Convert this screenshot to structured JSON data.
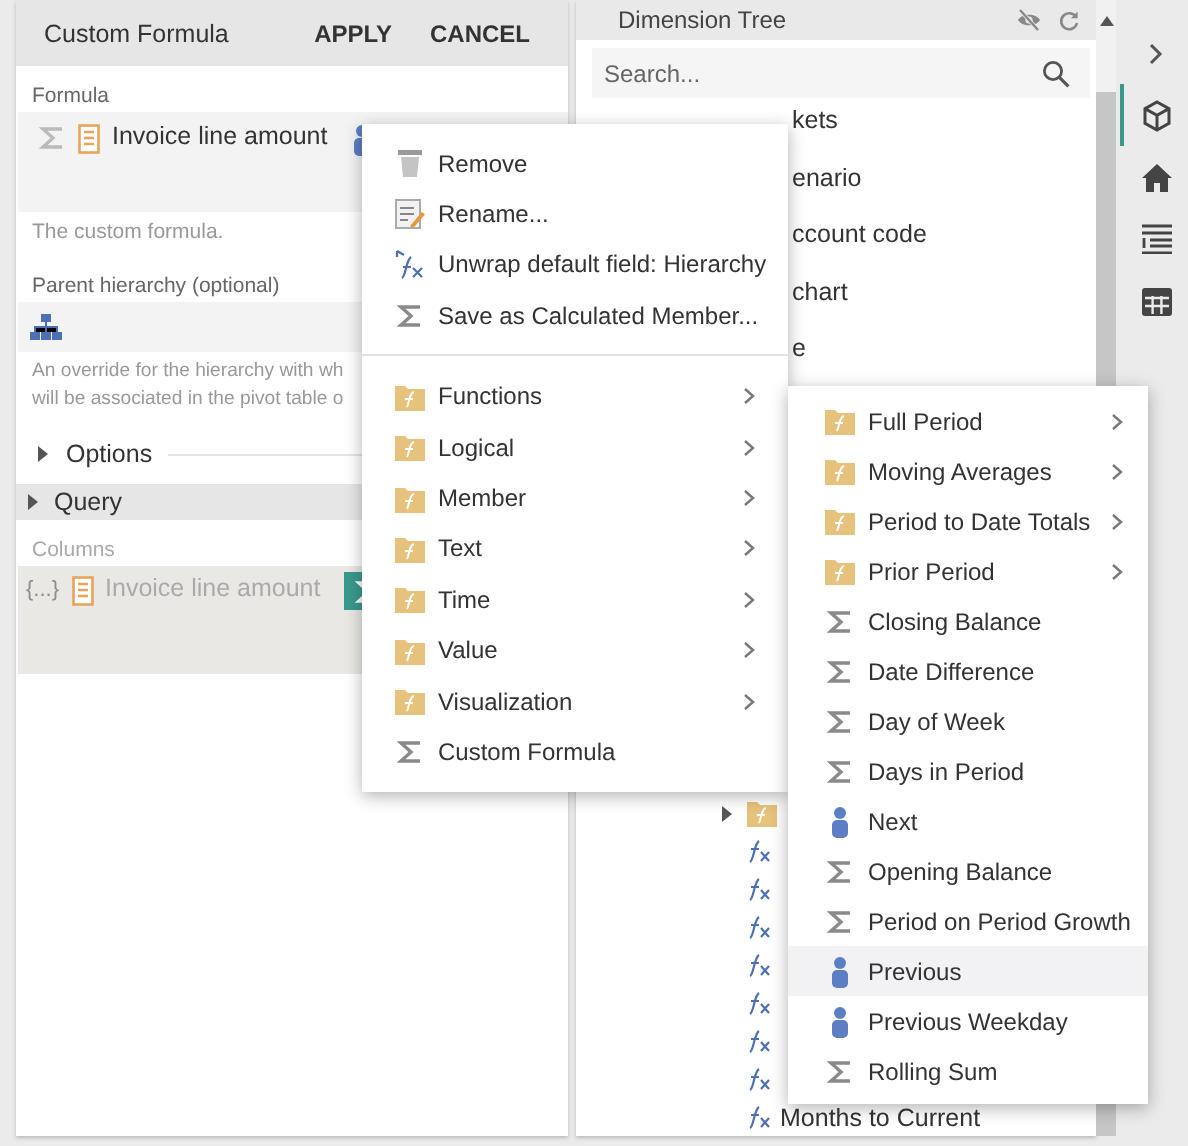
{
  "left_panel": {
    "title": "Custom Formula",
    "actions": [
      "APPLY",
      "CANCEL"
    ],
    "formula": {
      "label": "Formula",
      "tokens": [
        {
          "kind": "function"
        },
        {
          "kind": "field",
          "text": "Invoice line amount"
        },
        {
          "kind": "member"
        }
      ],
      "hint": "The custom formula."
    },
    "parent_hierarchy": {
      "label": "Parent hierarchy (optional)",
      "description_lines": [
        "An override for the hierarchy with wh",
        "will be associated in the pivot table o"
      ]
    },
    "options": {
      "label": "Options",
      "expanded": false
    },
    "query": {
      "label": "Query",
      "expanded": false,
      "columns_label": "Columns",
      "columns": [
        {
          "kind": "set",
          "text": "{...}"
        },
        {
          "kind": "field",
          "text": "Invoice line amount"
        },
        {
          "kind": "measure-chip"
        }
      ]
    }
  },
  "dimension_tree": {
    "title": "Dimension Tree",
    "search": {
      "placeholder": "Search..."
    },
    "top_rows": [
      {
        "text": "kets"
      },
      {
        "text": "enario"
      },
      {
        "text": "ccount code"
      },
      {
        "text": "chart"
      },
      {
        "text": "e"
      }
    ],
    "lower_rows": [
      {
        "kind": "folder",
        "expandable": true
      },
      {
        "kind": "function",
        "expandable": false
      },
      {
        "kind": "function",
        "expandable": false
      },
      {
        "kind": "function",
        "expandable": false
      },
      {
        "kind": "function",
        "expandable": false
      },
      {
        "kind": "function",
        "expandable": false
      },
      {
        "kind": "function",
        "expandable": false
      },
      {
        "kind": "function",
        "expandable": false
      },
      {
        "kind": "function",
        "expandable": false,
        "text": "Months to Current"
      }
    ]
  },
  "sidebar": {
    "items": [
      {
        "kind": "expand",
        "selected": false
      },
      {
        "kind": "model",
        "selected": true
      },
      {
        "kind": "home",
        "selected": false
      },
      {
        "kind": "fields",
        "selected": false
      },
      {
        "kind": "table",
        "selected": false
      }
    ]
  },
  "context_menu": {
    "groups": [
      [
        {
          "kind": "remove",
          "label": "Remove",
          "submenu": false
        },
        {
          "kind": "rename",
          "label": "Rename...",
          "submenu": false
        },
        {
          "kind": "unwrap",
          "label": "Unwrap default field: Hierarchy",
          "submenu": false
        },
        {
          "kind": "measure",
          "label": "Save as Calculated Member...",
          "submenu": false
        }
      ],
      [
        {
          "kind": "folder",
          "label": "Functions",
          "submenu": true
        },
        {
          "kind": "folder",
          "label": "Logical",
          "submenu": true
        },
        {
          "kind": "folder",
          "label": "Member",
          "submenu": true
        },
        {
          "kind": "folder",
          "label": "Text",
          "submenu": true
        },
        {
          "kind": "folder",
          "label": "Time",
          "submenu": true
        },
        {
          "kind": "folder",
          "label": "Value",
          "submenu": true
        },
        {
          "kind": "folder",
          "label": "Visualization",
          "submenu": true
        },
        {
          "kind": "measure",
          "label": "Custom Formula",
          "submenu": false
        }
      ]
    ]
  },
  "submenu": {
    "items": [
      {
        "kind": "folder",
        "label": "Full Period",
        "submenu": true,
        "selected": false
      },
      {
        "kind": "folder",
        "label": "Moving Averages",
        "submenu": true,
        "selected": false
      },
      {
        "kind": "folder",
        "label": "Period to Date Totals",
        "submenu": true,
        "selected": false
      },
      {
        "kind": "folder",
        "label": "Prior Period",
        "submenu": true,
        "selected": false
      },
      {
        "kind": "measure",
        "label": "Closing Balance",
        "submenu": false,
        "selected": false
      },
      {
        "kind": "measure",
        "label": "Date Difference",
        "submenu": false,
        "selected": false
      },
      {
        "kind": "measure",
        "label": "Day of Week",
        "submenu": false,
        "selected": false
      },
      {
        "kind": "measure",
        "label": "Days in Period",
        "submenu": false,
        "selected": false
      },
      {
        "kind": "member",
        "label": "Next",
        "submenu": false,
        "selected": false
      },
      {
        "kind": "measure",
        "label": "Opening Balance",
        "submenu": false,
        "selected": false
      },
      {
        "kind": "measure",
        "label": "Period on Period Growth",
        "submenu": false,
        "selected": false
      },
      {
        "kind": "member",
        "label": "Previous",
        "submenu": false,
        "selected": true
      },
      {
        "kind": "member",
        "label": "Previous Weekday",
        "submenu": false,
        "selected": false
      },
      {
        "kind": "measure",
        "label": "Rolling Sum",
        "submenu": false,
        "selected": false
      }
    ]
  }
}
